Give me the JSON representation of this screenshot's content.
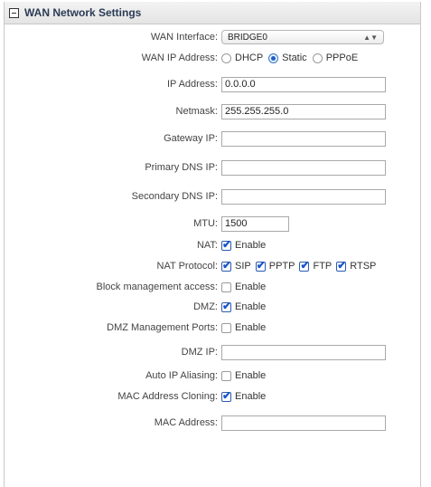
{
  "section": {
    "title": "WAN Network Settings"
  },
  "wan_interface": {
    "label": "WAN Interface:",
    "value": "BRIDGE0"
  },
  "wan_ip_address": {
    "label": "WAN IP Address:",
    "options": [
      "DHCP",
      "Static",
      "PPPoE"
    ],
    "selected": "Static"
  },
  "ip_address": {
    "label": "IP Address:",
    "value": "0.0.0.0"
  },
  "netmask": {
    "label": "Netmask:",
    "value": "255.255.255.0"
  },
  "gateway_ip": {
    "label": "Gateway IP:",
    "value": ""
  },
  "primary_dns": {
    "label": "Primary DNS IP:",
    "value": ""
  },
  "secondary_dns": {
    "label": "Secondary DNS IP:",
    "value": ""
  },
  "mtu": {
    "label": "MTU:",
    "value": "1500"
  },
  "nat": {
    "label": "NAT:",
    "option": "Enable",
    "checked": true
  },
  "nat_protocol": {
    "label": "NAT Protocol:",
    "options": [
      {
        "label": "SIP",
        "checked": true
      },
      {
        "label": "PPTP",
        "checked": true
      },
      {
        "label": "FTP",
        "checked": true
      },
      {
        "label": "RTSP",
        "checked": true
      }
    ]
  },
  "block_management": {
    "label": "Block management access:",
    "option": "Enable",
    "checked": false
  },
  "dmz": {
    "label": "DMZ:",
    "option": "Enable",
    "checked": true
  },
  "dmz_management_ports": {
    "label": "DMZ Management Ports:",
    "option": "Enable",
    "checked": false
  },
  "dmz_ip": {
    "label": "DMZ IP:",
    "value": ""
  },
  "auto_ip_aliasing": {
    "label": "Auto IP Aliasing:",
    "option": "Enable",
    "checked": false
  },
  "mac_cloning": {
    "label": "MAC Address Cloning:",
    "option": "Enable",
    "checked": true
  },
  "mac_address": {
    "label": "MAC Address:",
    "value": ""
  }
}
